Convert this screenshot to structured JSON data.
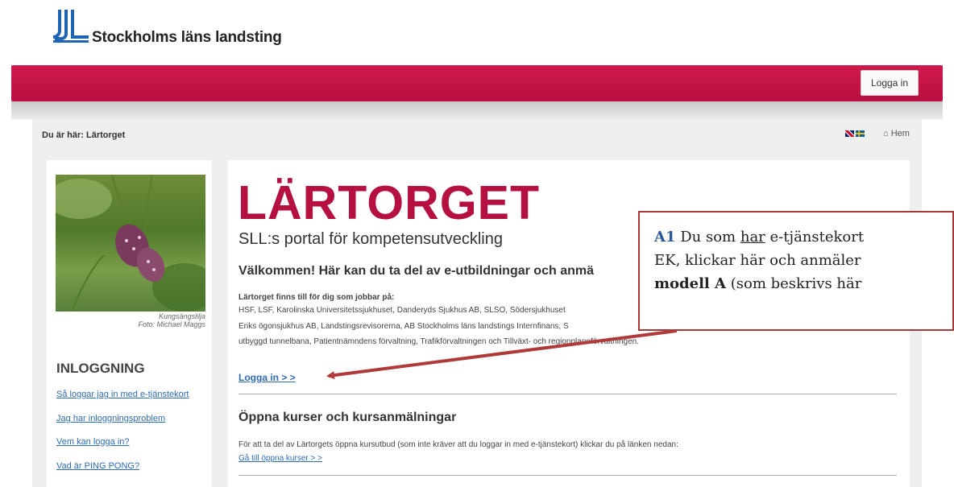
{
  "header": {
    "logo_text": "Stockholms läns landsting",
    "login_button": "Logga in"
  },
  "breadcrumb": "Du är här: Lärtorget",
  "home_label": "Hem",
  "sidebar": {
    "photo_caption_1": "Kungsängslilja",
    "photo_caption_2": "Foto: Michael Maggs",
    "heading": "INLOGGNING",
    "links": [
      "Så loggar jag in med e-tjänstekort",
      "Jag har inloggningsproblem",
      "Vem kan logga in?",
      "Vad är PING PONG?"
    ]
  },
  "main": {
    "title": "LÄRTORGET",
    "subtitle": "SLL:s portal för kompetensutveckling",
    "welcome": "Välkommen! Här kan du ta del av e-utbildningar och anmä",
    "for_you": "Lärtorget finns till för dig som jobbar på:",
    "line1": "HSF, LSF, Karolinska Universitetssjukhuset, Danderyds Sjukhus AB, SLSO, Södersjukhuset",
    "line2": "Eriks ögonsjukhus AB, Landstingsrevisorerna, AB Stockholms läns landstings Internfinans, S",
    "line3": "utbyggd tunnelbana, Patientnämndens förvaltning, Trafikförvaltningen och Tillväxt- och regionplaneförvaltningen.",
    "login_link": "Logga in > >",
    "open_heading": "Öppna kurser och kursanmälningar",
    "open_text": "För att ta del av Lärtorgets öppna kursutbud (som inte kräver att du loggar in med e-tjänstekort) klickar du på länken nedan:",
    "open_link": "Gå till öppna kurser > >"
  },
  "annotation": {
    "label": "A1",
    "l1_pre": "Du som",
    "l1_u": "har",
    "l1_post": "e-tjänstekort",
    "l2": "EK, klickar här och anmäler",
    "l3_bold": "modell A",
    "l3_rest": "(som beskrivs här"
  },
  "colors": {
    "brand": "#b5103f",
    "link": "#2e6bb5",
    "arrow": "#b03a3a"
  }
}
